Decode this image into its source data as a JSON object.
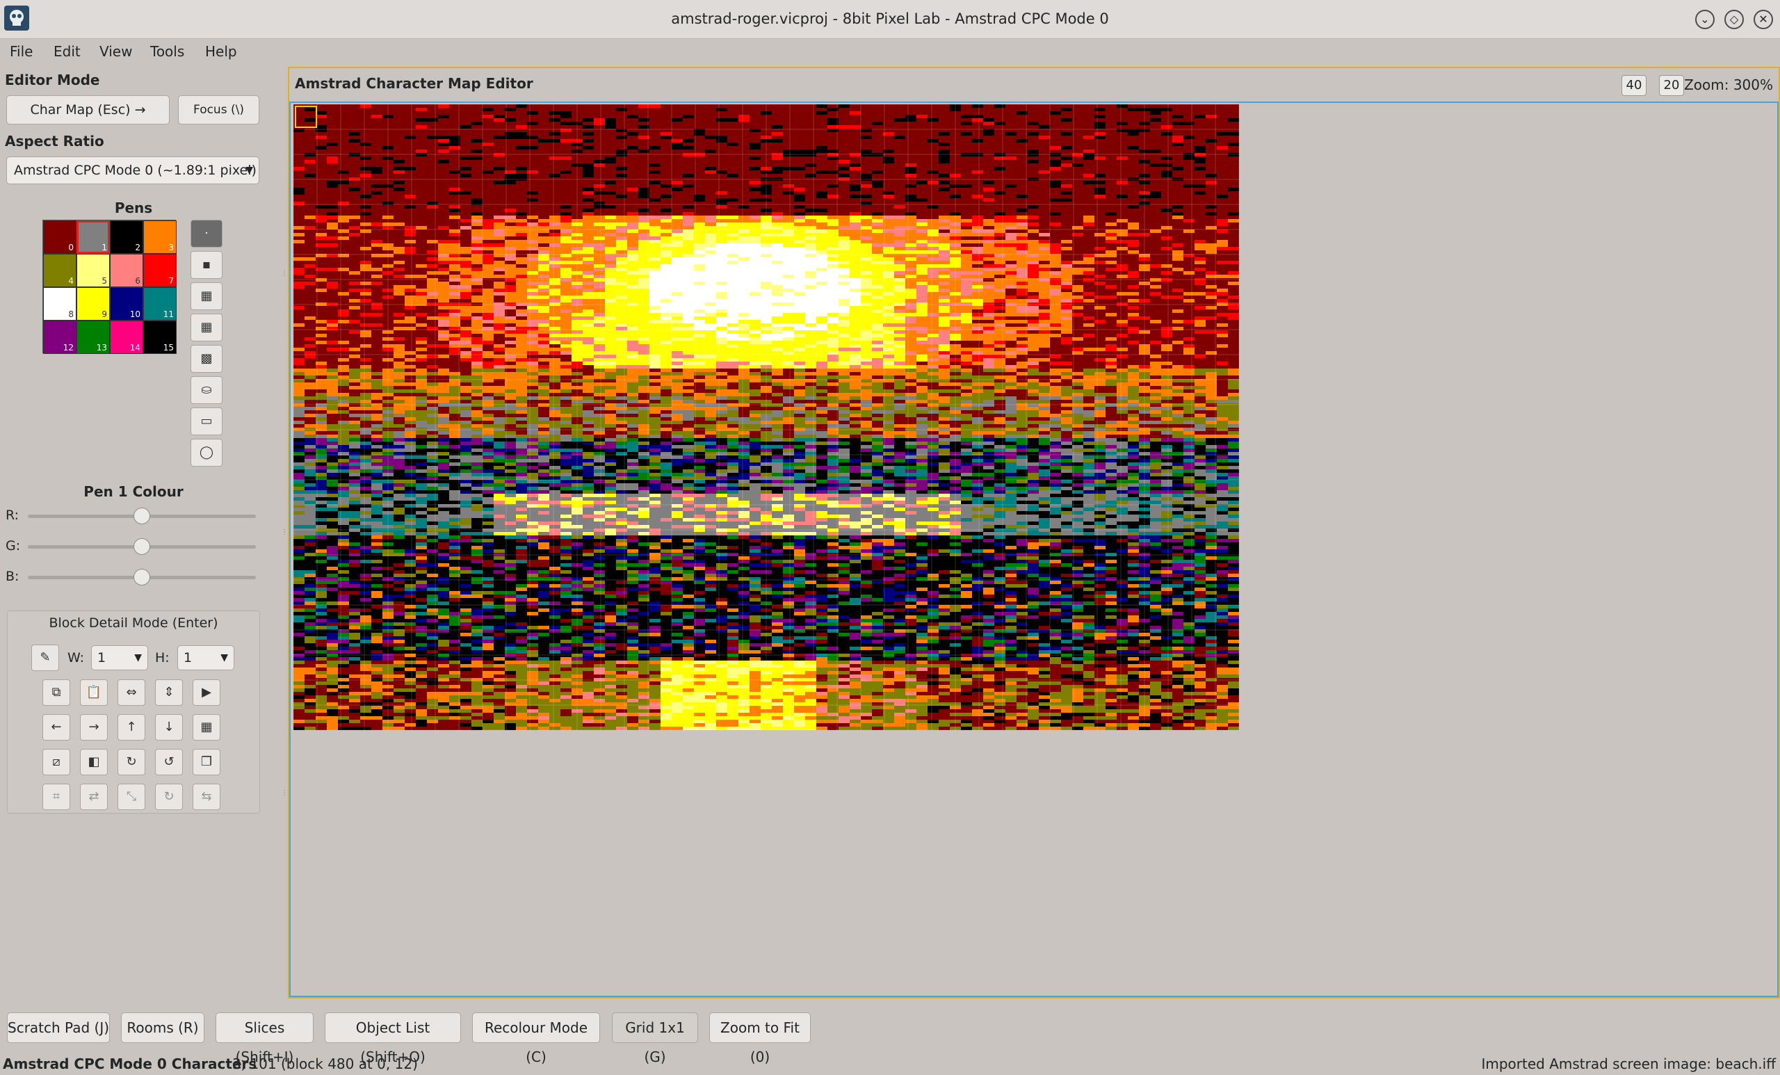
{
  "window": {
    "title": "amstrad-roger.vicproj - 8bit Pixel Lab - Amstrad CPC Mode 0",
    "buttons": [
      "⌄",
      "◇",
      "✕"
    ]
  },
  "menu": [
    "File",
    "Edit",
    "View",
    "Tools",
    "Help"
  ],
  "left_panel": {
    "editor_mode_label": "Editor Mode",
    "char_map_button": "Char Map (Esc) →",
    "focus_button": "Focus (\\)",
    "aspect_ratio_label": "Aspect Ratio",
    "aspect_ratio_value": "Amstrad CPC Mode 0 (~1.89:1 pixel)",
    "pens_label": "Pens",
    "pens": [
      {
        "index": "0",
        "color": "#800000"
      },
      {
        "index": "1",
        "color": "#808080"
      },
      {
        "index": "2",
        "color": "#000000"
      },
      {
        "index": "3",
        "color": "#ff8000"
      },
      {
        "index": "4",
        "color": "#808000"
      },
      {
        "index": "5",
        "color": "#ffff80"
      },
      {
        "index": "6",
        "color": "#ff8080"
      },
      {
        "index": "7",
        "color": "#ff0000"
      },
      {
        "index": "8",
        "color": "#ffffff"
      },
      {
        "index": "9",
        "color": "#ffff00"
      },
      {
        "index": "10",
        "color": "#000080"
      },
      {
        "index": "11",
        "color": "#008080"
      },
      {
        "index": "12",
        "color": "#800080"
      },
      {
        "index": "13",
        "color": "#008000"
      },
      {
        "index": "14",
        "color": "#ff0080"
      },
      {
        "index": "15",
        "color": "#000000"
      }
    ],
    "selected_pen": 1,
    "tools": [
      "brush-1px-icon",
      "brush-2px-icon",
      "brush-3px-icon",
      "brush-4px-icon",
      "brush-5px-icon",
      "fill-bucket-icon",
      "rectangle-icon",
      "ellipse-icon"
    ],
    "pen_colour_label": "Pen 1 Colour",
    "sliders": [
      {
        "label": "R:",
        "value": 0.5
      },
      {
        "label": "G:",
        "value": 0.5
      },
      {
        "label": "B:",
        "value": 0.5
      }
    ],
    "block_detail": {
      "title": "Block Detail Mode (Enter)",
      "w_label": "W:",
      "w_value": "1",
      "h_label": "H:",
      "h_value": "1",
      "rows": [
        [
          "copy-icon",
          "paste-icon",
          "flip-horizontal-icon",
          "flip-vertical-icon",
          "play-icon"
        ],
        [
          "arrow-left-icon",
          "arrow-right-icon",
          "arrow-up-icon",
          "arrow-down-icon",
          "grid-icon"
        ],
        [
          "clear-icon",
          "invert-icon",
          "rotate-clockwise-icon",
          "rotate-counterclockwise-icon",
          "shadow-icon"
        ],
        [
          "crop-icon",
          "swap-horizontal-icon",
          "resize-icon",
          "rotate-more-icon",
          "swap-colors-icon"
        ]
      ]
    }
  },
  "editor": {
    "title": "Amstrad Character Map Editor",
    "width_chars": "40",
    "height_chars": "20",
    "zoom": "Zoom: 300%"
  },
  "bottom_buttons": [
    "Scratch Pad (J)",
    "Rooms (R)",
    "Slices (Shift+I)",
    "Object List (Shift+O)",
    "Recolour Mode (C)",
    "Grid 1x1 (G)",
    "Zoom to Fit (0)"
  ],
  "status": {
    "mode": "Amstrad CPC Mode 0 Characters",
    "position": "3, 101 (block 480 at 0, 12)",
    "message": "Imported Amstrad screen image: beach.iff"
  }
}
